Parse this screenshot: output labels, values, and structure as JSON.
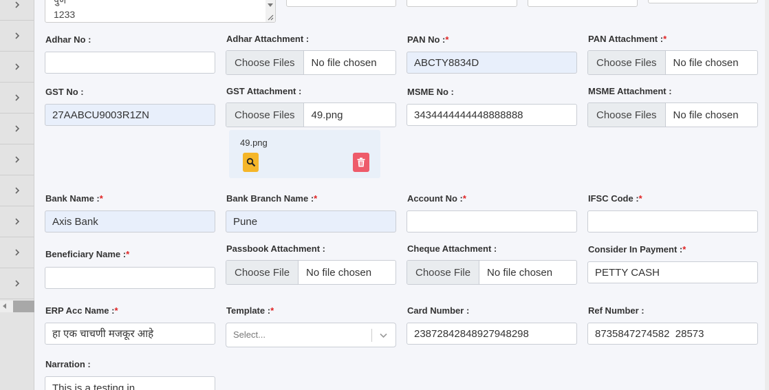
{
  "top_fragment": {
    "line1": "पुणे",
    "line2": "1233"
  },
  "fields": {
    "adhar_no": {
      "label": "Adhar No :",
      "value": ""
    },
    "adhar_attachment": {
      "label": "Adhar Attachment :",
      "button": "Choose Files",
      "file": "No file chosen"
    },
    "pan_no": {
      "label": "PAN No :",
      "value": "ABCTY8834D"
    },
    "pan_attachment": {
      "label": "PAN Attachment :",
      "button": "Choose Files",
      "file": "No file chosen"
    },
    "gst_no": {
      "label": "GST No :",
      "value": "27AABCU9003R1ZN"
    },
    "gst_attachment": {
      "label": "GST Attachment :",
      "button": "Choose Files",
      "file": "49.png"
    },
    "msme_no": {
      "label": "MSME No :",
      "value": "3434444444448888888"
    },
    "msme_attachment": {
      "label": "MSME Attachment :",
      "button": "Choose Files",
      "file": "No file chosen"
    },
    "bank_name": {
      "label": "Bank Name :",
      "value": "Axis Bank"
    },
    "bank_branch": {
      "label": "Bank Branch Name :",
      "value": "Pune"
    },
    "account_no": {
      "label": "Account No :",
      "value": ""
    },
    "ifsc_code": {
      "label": "IFSC Code :",
      "value": ""
    },
    "beneficiary_name": {
      "label": "Beneficiary Name :",
      "value": ""
    },
    "passbook_attachment": {
      "label": "Passbook Attachment :",
      "button": "Choose File",
      "file": "No file chosen"
    },
    "cheque_attachment": {
      "label": "Cheque Attachment :",
      "button": "Choose File",
      "file": "No file chosen"
    },
    "consider_in_payment": {
      "label": "Consider In Payment :",
      "value": "PETTY CASH"
    },
    "erp_acc_name": {
      "label": "ERP Acc Name :",
      "value": "हा एक चाचणी मजकूर आहे"
    },
    "template": {
      "label": "Template :",
      "placeholder": "Select..."
    },
    "card_number": {
      "label": "Card Number :",
      "value": "23872842848927948298"
    },
    "ref_number": {
      "label": "Ref Number :",
      "value": "8735847274582  28573"
    },
    "narration": {
      "label": "Narration :",
      "value": "This is a testing in"
    }
  },
  "required_mark": "*",
  "gst_preview": {
    "filename": "49.png"
  },
  "icons": {
    "rail": "chevron-right-icon",
    "view": "magnifier-icon",
    "delete": "trash-icon",
    "select": "chevron-down-icon"
  },
  "colors": {
    "required": "#e02424",
    "filled_input": "#e8effb",
    "view_button": "#f5b629",
    "delete_button": "#ee5b6a"
  }
}
